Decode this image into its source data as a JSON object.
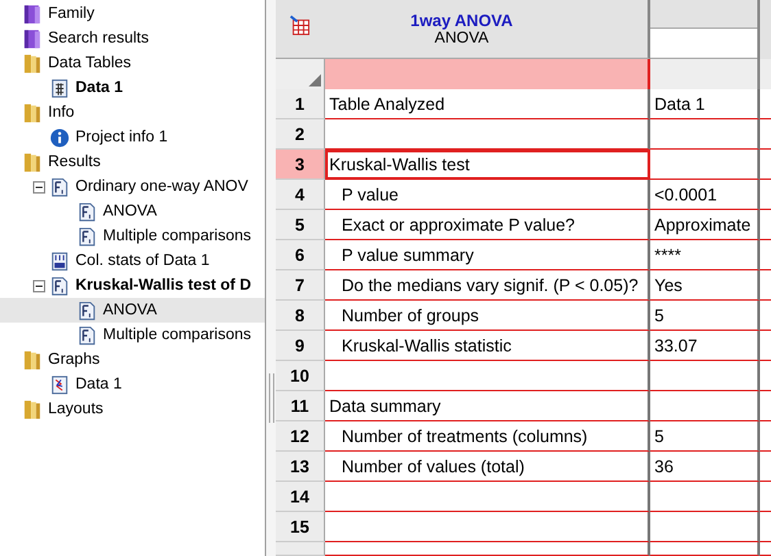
{
  "tree": [
    {
      "label": "Family",
      "kind": "family-folder",
      "current": false,
      "selected": false
    },
    {
      "label": "Search results",
      "kind": "family-folder",
      "current": false,
      "selected": false
    },
    {
      "label": "Data Tables",
      "kind": "folder",
      "current": false,
      "selected": false,
      "children": [
        {
          "label": "Data 1",
          "kind": "data-table",
          "current": true,
          "selected": false
        }
      ]
    },
    {
      "label": "Info",
      "kind": "folder",
      "current": false,
      "selected": false,
      "children": [
        {
          "label": "Project info 1",
          "kind": "info",
          "current": false,
          "selected": false
        }
      ]
    },
    {
      "label": "Results",
      "kind": "folder",
      "current": false,
      "selected": false,
      "children": [
        {
          "label": "Ordinary one-way ANOV",
          "kind": "result-sheet",
          "current": false,
          "selected": false,
          "expanded": true,
          "children": [
            {
              "label": "ANOVA",
              "kind": "result-sheet",
              "current": false,
              "selected": false
            },
            {
              "label": "Multiple comparisons",
              "kind": "result-sheet",
              "current": false,
              "selected": false
            }
          ]
        },
        {
          "label": "Col. stats of Data 1",
          "kind": "stats-sheet",
          "current": false,
          "selected": false
        },
        {
          "label": "Kruskal-Wallis test of D",
          "kind": "result-sheet",
          "current": true,
          "selected": false,
          "expanded": true,
          "children": [
            {
              "label": "ANOVA",
              "kind": "result-sheet",
              "current": false,
              "selected": true
            },
            {
              "label": "Multiple comparisons",
              "kind": "result-sheet",
              "current": false,
              "selected": false
            }
          ]
        }
      ]
    },
    {
      "label": "Graphs",
      "kind": "folder",
      "current": false,
      "selected": false,
      "children": [
        {
          "label": "Data 1",
          "kind": "graph",
          "current": false,
          "selected": false
        }
      ]
    },
    {
      "label": "Layouts",
      "kind": "folder",
      "current": false,
      "selected": false
    }
  ],
  "sheet": {
    "title": "1way ANOVA",
    "subtitle": "ANOVA",
    "rows": [
      {
        "number": "1",
        "label": "Table Analyzed",
        "value": "Data 1",
        "indented": false,
        "selected": false
      },
      {
        "number": "2",
        "selected": false
      },
      {
        "number": "3",
        "label": "Kruskal-Wallis test",
        "indented": false,
        "selected": true
      },
      {
        "number": "4",
        "label": "P value",
        "value": "<0.0001",
        "indented": true,
        "selected": false
      },
      {
        "number": "5",
        "label": "Exact or approximate P value?",
        "value": "Approximate",
        "indented": true,
        "selected": false
      },
      {
        "number": "6",
        "label": "P value summary",
        "value": "****",
        "indented": true,
        "selected": false
      },
      {
        "number": "7",
        "label": "Do the medians vary signif. (P < 0.05)?",
        "value": "Yes",
        "indented": true,
        "selected": false
      },
      {
        "number": "8",
        "label": "Number of groups",
        "value": "5",
        "indented": true,
        "selected": false
      },
      {
        "number": "9",
        "label": "Kruskal-Wallis statistic",
        "value": "33.07",
        "indented": true,
        "selected": false
      },
      {
        "number": "10",
        "selected": false
      },
      {
        "number": "11",
        "label": "Data summary",
        "indented": false,
        "selected": false
      },
      {
        "number": "12",
        "label": "Number of treatments (columns)",
        "value": "5",
        "indented": true,
        "selected": false
      },
      {
        "number": "13",
        "label": "Number of values (total)",
        "value": "36",
        "indented": true,
        "selected": false
      },
      {
        "number": "14",
        "selected": false
      },
      {
        "number": "15",
        "selected": false
      }
    ]
  }
}
